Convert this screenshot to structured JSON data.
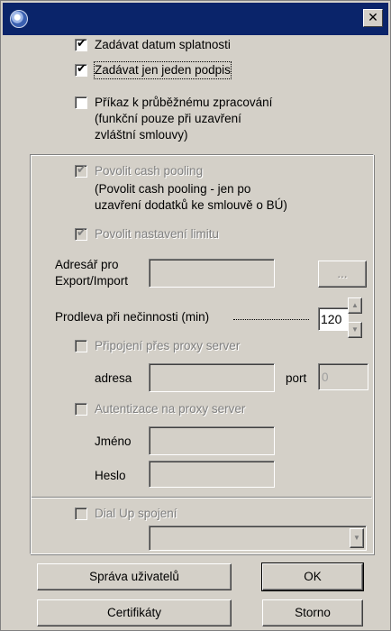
{
  "window": {
    "title": "",
    "close_glyph": "✕",
    "icon": "app-globe-icon"
  },
  "checkboxes": {
    "due_date": {
      "label": "Zadávat datum splatnosti",
      "checked": true
    },
    "single_signature": {
      "label": "Zadávat jen jeden podpis",
      "checked": true
    },
    "continuous_processing": {
      "label": "Příkaz k průběžnému zpracování",
      "note_line1": "(funkční pouze při uzavření",
      "note_line2": "zvláštní smlouvy)",
      "checked": false
    },
    "cash_pooling": {
      "label": "Povolit cash pooling",
      "note_line1": "(Povolit cash pooling  - jen po",
      "note_line2": "uzavření dodatků ke smlouvě o BÚ)",
      "checked": true
    },
    "limit_setting": {
      "label": "Povolit nastavení limitu",
      "checked": true
    },
    "proxy_connection": {
      "label": "Připojení přes proxy server",
      "checked": false
    },
    "proxy_auth": {
      "label": "Autentizace na proxy server",
      "checked": false
    },
    "dialup": {
      "label": "Dial Up spojení",
      "checked": false
    }
  },
  "export_import": {
    "label_line1": "Adresář pro",
    "label_line2": "Export/Import",
    "value": "",
    "browse_label": "..."
  },
  "idle_delay": {
    "label": "Prodleva při nečinnosti (min)",
    "value": "120",
    "up": "▲",
    "down": "▼"
  },
  "proxy": {
    "address_label": "adresa",
    "address_value": "",
    "port_label": "port",
    "port_value": "0"
  },
  "auth": {
    "name_label": "Jméno",
    "name_value": "",
    "password_label": "Heslo",
    "password_value": ""
  },
  "dialup_select": {
    "value": "",
    "arrow": "▼"
  },
  "buttons": {
    "user_management": "Správa uživatelů",
    "ok": "OK",
    "certificates": "Certifikáty",
    "cancel": "Storno"
  }
}
